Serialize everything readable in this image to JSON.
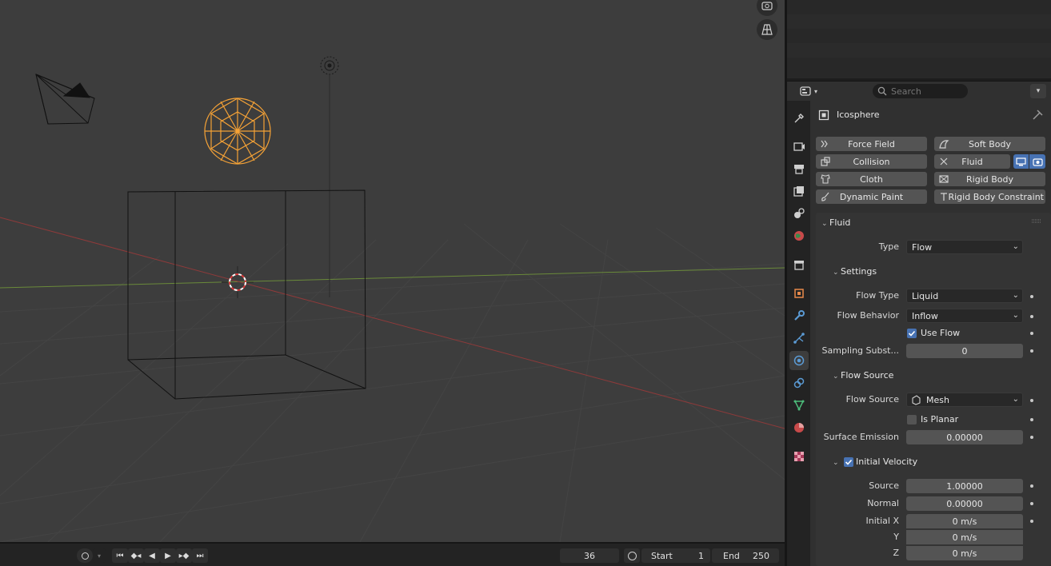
{
  "timeline": {
    "current_frame": "36",
    "start_label": "Start",
    "start_value": "1",
    "end_label": "End",
    "end_value": "250"
  },
  "properties": {
    "search_placeholder": "Search",
    "object_name": "Icosphere",
    "physics_buttons": {
      "force_field": "Force Field",
      "soft_body": "Soft Body",
      "collision": "Collision",
      "fluid": "Fluid",
      "cloth": "Cloth",
      "rigid_body": "Rigid Body",
      "dynamic_paint": "Dynamic Paint",
      "rigid_body_constraint": "Rigid Body Constraint"
    },
    "fluid_panel": {
      "title": "Fluid",
      "type_label": "Type",
      "type_value": "Flow",
      "settings": {
        "title": "Settings",
        "flow_type_label": "Flow Type",
        "flow_type_value": "Liquid",
        "flow_behavior_label": "Flow Behavior",
        "flow_behavior_value": "Inflow",
        "use_flow_label": "Use Flow",
        "use_flow_checked": true,
        "sampling_label": "Sampling Subst...",
        "sampling_value": "0"
      },
      "flow_source": {
        "title": "Flow Source",
        "source_label": "Flow Source",
        "source_value": "Mesh",
        "is_planar_label": "Is Planar",
        "is_planar_checked": false,
        "surface_emission_label": "Surface Emission",
        "surface_emission_value": "0.00000"
      },
      "initial_velocity": {
        "title": "Initial Velocity",
        "enabled": true,
        "source_label": "Source",
        "source_value": "1.00000",
        "normal_label": "Normal",
        "normal_value": "0.00000",
        "initial_x_label": "Initial X",
        "initial_x_value": "0 m/s",
        "y_label": "Y",
        "y_value": "0 m/s",
        "z_label": "Z",
        "z_value": "0 m/s"
      }
    }
  },
  "colors": {
    "accent": "#4772b3",
    "selection": "#f5a236",
    "x_axis": "#8e3a3a",
    "y_axis": "#6a8a3a"
  }
}
